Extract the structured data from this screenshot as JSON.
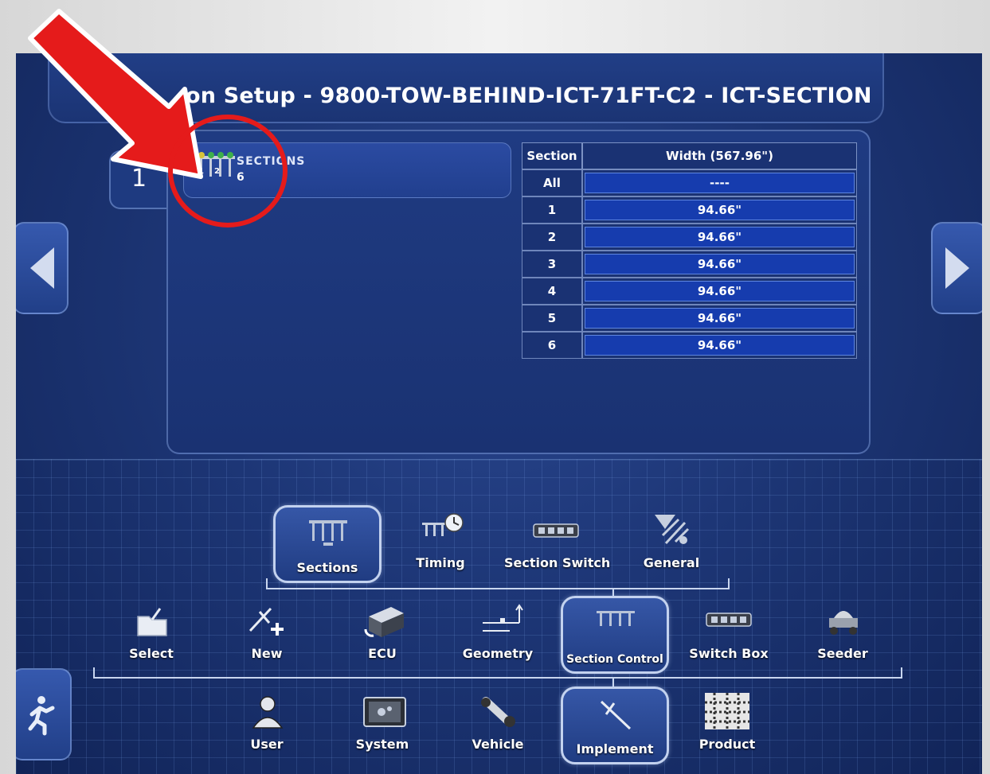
{
  "page_title": "on Setup - 9800-TOW-BEHIND-ICT-71FT-C2 - ICT-SECTION",
  "configuration": {
    "index": "1",
    "row_label": "SECTIONS",
    "row_count": "6"
  },
  "table": {
    "headers": [
      "Section",
      "Width (567.96\")"
    ],
    "rows": [
      {
        "section": "All",
        "width": "----"
      },
      {
        "section": "1",
        "width": "94.66\""
      },
      {
        "section": "2",
        "width": "94.66\""
      },
      {
        "section": "3",
        "width": "94.66\""
      },
      {
        "section": "4",
        "width": "94.66\""
      },
      {
        "section": "5",
        "width": "94.66\""
      },
      {
        "section": "6",
        "width": "94.66\""
      }
    ]
  },
  "tier3": [
    {
      "label": "Sections",
      "icon": "sections-icon",
      "selected": true
    },
    {
      "label": "Timing",
      "icon": "timing-icon",
      "selected": false
    },
    {
      "label": "Section Switch",
      "icon": "section-switch-icon",
      "selected": false
    },
    {
      "label": "General",
      "icon": "general-icon",
      "selected": false
    }
  ],
  "tier2": [
    {
      "label": "Select",
      "icon": "folder-icon",
      "selected": false
    },
    {
      "label": "New",
      "icon": "new-implement-icon",
      "selected": false
    },
    {
      "label": "ECU",
      "icon": "ecu-icon",
      "selected": false
    },
    {
      "label": "Geometry",
      "icon": "geometry-icon",
      "selected": false
    },
    {
      "label": "Section Control",
      "icon": "section-control-icon",
      "selected": true
    },
    {
      "label": "Switch Box",
      "icon": "switch-box-icon",
      "selected": false
    },
    {
      "label": "Seeder",
      "icon": "seeder-icon",
      "selected": false
    }
  ],
  "tier1": [
    {
      "label": "User",
      "icon": "user-icon",
      "selected": false
    },
    {
      "label": "System",
      "icon": "system-icon",
      "selected": false
    },
    {
      "label": "Vehicle",
      "icon": "vehicle-icon",
      "selected": false
    },
    {
      "label": "Implement",
      "icon": "implement-icon",
      "selected": true
    },
    {
      "label": "Product",
      "icon": "product-icon",
      "selected": false
    }
  ],
  "annotation": {
    "arrow_color": "#e51b1b",
    "circle_color": "#e51b1b"
  },
  "colors": {
    "panel_bg": "#1d3676",
    "accent_blue": "#163cae"
  }
}
